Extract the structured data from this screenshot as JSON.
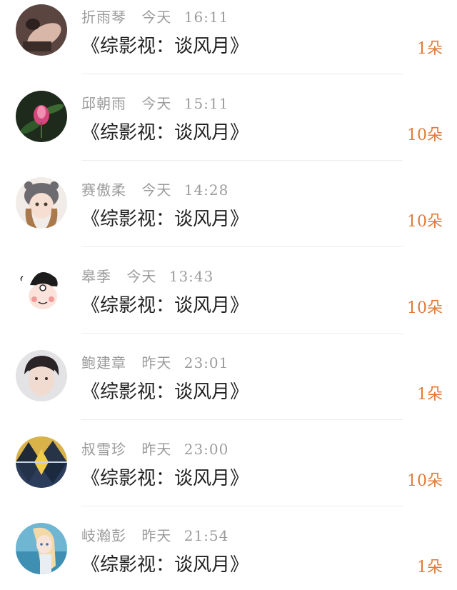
{
  "gifts": [
    {
      "name": "折雨琴",
      "day": "今天",
      "time": "16:11",
      "title": "《综影视：谈风月》",
      "count": "1朵"
    },
    {
      "name": "邱朝雨",
      "day": "今天",
      "time": "15:11",
      "title": "《综影视：谈风月》",
      "count": "10朵"
    },
    {
      "name": "赛傲柔",
      "day": "今天",
      "time": "14:28",
      "title": "《综影视：谈风月》",
      "count": "10朵"
    },
    {
      "name": "皋季",
      "day": "今天",
      "time": "13:43",
      "title": "《综影视：谈风月》",
      "count": "10朵"
    },
    {
      "name": "鲍建章",
      "day": "昨天",
      "time": "23:01",
      "title": "《综影视：谈风月》",
      "count": "1朵"
    },
    {
      "name": "叔雪珍",
      "day": "昨天",
      "time": "23:00",
      "title": "《综影视：谈风月》",
      "count": "10朵"
    },
    {
      "name": "岐瀚彭",
      "day": "昨天",
      "time": "21:54",
      "title": "《综影视：谈风月》",
      "count": "1朵"
    }
  ],
  "colors": {
    "meta": "#9c9c9c",
    "title": "#222222",
    "count": "#e07b39",
    "divider": "#ececec"
  }
}
